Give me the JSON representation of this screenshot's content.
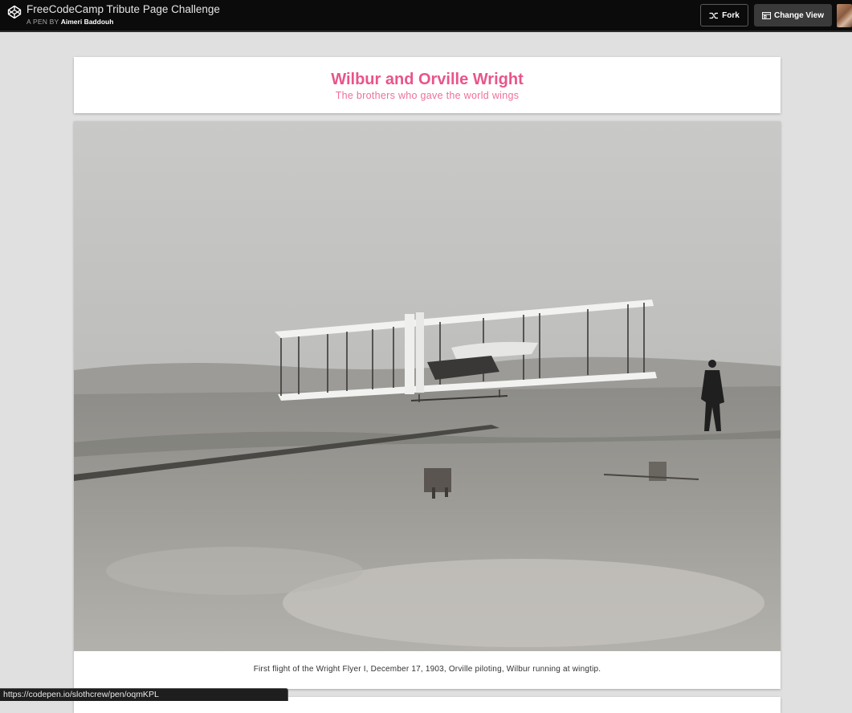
{
  "topbar": {
    "pen_title": "FreeCodeCamp Tribute Page Challenge",
    "byline_prefix": "A PEN BY",
    "author": "Aimeri Baddouh",
    "fork_label": "Fork",
    "change_view_label": "Change View",
    "icons": {
      "logo": "codepen-logo-icon",
      "fork": "fork-icon",
      "change_view": "layout-icon"
    }
  },
  "tribute": {
    "title": "Wilbur and Orville Wright",
    "subtitle": "The brothers who gave the world wings",
    "image_caption": "First flight of the Wright Flyer I, December 17, 1903, Orville piloting, Wilbur running at wingtip."
  },
  "statusbar": {
    "url": "https://codepen.io/slothcrew/pen/oqmKPL"
  },
  "colors": {
    "accent_pink": "#e8558a",
    "topbar_bg": "#0b0b0b",
    "page_bg": "#e0e0e0"
  }
}
